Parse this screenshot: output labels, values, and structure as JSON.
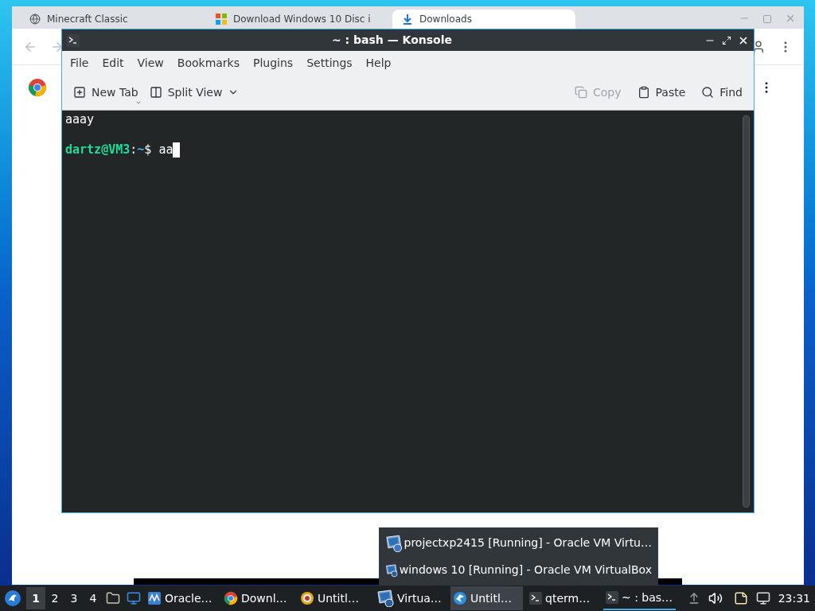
{
  "browser": {
    "tabs": [
      {
        "title": "Minecraft Classic",
        "selected": false
      },
      {
        "title": "Download Windows 10 Disc i",
        "selected": false
      },
      {
        "title": "Downloads",
        "selected": true
      }
    ]
  },
  "konsole": {
    "title": "~ : bash — Konsole",
    "menu": [
      "File",
      "Edit",
      "View",
      "Bookmarks",
      "Plugins",
      "Settings",
      "Help"
    ],
    "toolbar_left": [
      {
        "label": "New Tab",
        "kind": "newtab"
      },
      {
        "label": "Split View",
        "kind": "split"
      }
    ],
    "toolbar_right": [
      {
        "label": "Copy",
        "kind": "copy",
        "disabled": true
      },
      {
        "label": "Paste",
        "kind": "paste",
        "disabled": false
      },
      {
        "label": "Find",
        "kind": "find",
        "disabled": false
      }
    ],
    "terminal": {
      "output": "aaay",
      "user_host": "dartz@VM3",
      "separator": ":",
      "path": "~",
      "symbol": "$",
      "input": "aa"
    }
  },
  "popup": {
    "items": [
      {
        "label": "projectxp2415 [Running] - Oracle VM Virtu…",
        "kind": "xp"
      },
      {
        "label": "windows 10 [Running] - Oracle VM VirtualBox",
        "kind": "win10"
      }
    ]
  },
  "taskbar": {
    "desktops": [
      {
        "label": "1",
        "selected": true
      },
      {
        "label": "2",
        "selected": false
      },
      {
        "label": "3",
        "selected": false
      },
      {
        "label": "4",
        "selected": false
      }
    ],
    "tasks": [
      {
        "label": "Oracle…",
        "kind": "vbox",
        "selected": false,
        "focused": false
      },
      {
        "label": "Downl…",
        "kind": "chrome",
        "selected": false,
        "focused": false
      },
      {
        "label": "Untitl…",
        "kind": "target",
        "selected": false,
        "focused": false
      },
      {
        "label": "Virtua…",
        "kind": "win10",
        "selected": false,
        "focused": false
      },
      {
        "label": "Untitl…",
        "kind": "bird",
        "selected": true,
        "focused": false
      },
      {
        "label": "qterm…",
        "kind": "terminal",
        "selected": false,
        "focused": false
      },
      {
        "label": "~ : bas…",
        "kind": "terminal",
        "selected": false,
        "focused": true
      }
    ],
    "clock": "23:31"
  }
}
